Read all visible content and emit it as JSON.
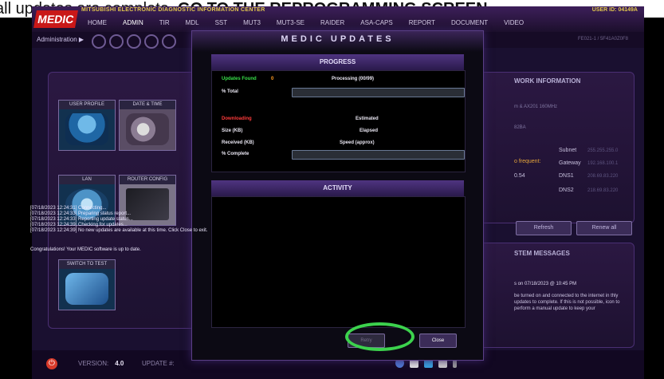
{
  "caption": {
    "part1": "all updates are complete, ",
    "part2": "GO TO THE REPROGRAMMING SCREEN"
  },
  "app": {
    "logo": "MEDIC",
    "title": "MITSUBISHI ELECTRONIC DIAGNOSTIC INFORMATION CENTER",
    "user_id_label": "USER ID:",
    "user_id_value": "04149A",
    "nav_tabs": [
      "HOME",
      "ADMIN",
      "TIR",
      "MDL",
      "SST",
      "MUT3",
      "MUT3-SE",
      "RAIDER",
      "ASA-CAPS",
      "REPORT",
      "DOCUMENT",
      "VIDEO"
    ],
    "breadcrumb": "Administration  ▶",
    "id_text": "FE021-1 / 5F41A0Z0F8"
  },
  "left_tiles": [
    {
      "label": "USER PROFILE"
    },
    {
      "label": "DATE & TIME"
    },
    {
      "label": "LAN"
    },
    {
      "label": "ROUTER CONFIG"
    },
    {
      "label": "SWITCH TO TEST"
    }
  ],
  "right_panel": {
    "title": "WORK INFORMATION",
    "cpu_text": "m & AX201 160MHz",
    "mac_text": "82BA",
    "freq_label": "o frequent:",
    "freq_value": "0.54",
    "subnet_label": "Subnet",
    "subnet_value": "255.255.255.0",
    "gateway_label": "Gateway",
    "gateway_value": "192.168.100.1",
    "dns1_label": "DNS1",
    "dns1_value": "208.69.83.220",
    "dns2_label": "DNS2",
    "dns2_value": "218.69.83.220",
    "refresh_label": "Refresh",
    "renew_label": "Renew all"
  },
  "messages_panel": {
    "title": "STEM MESSAGES",
    "date_line": "s on 07/18/2023 @ 10:45 PM",
    "body": "be turned on and connected to the internet in thly updates to complete. If this is not possible, icon to perform a manual update to keep your"
  },
  "bottom": {
    "version_label": "VERSION:",
    "version_value": "4.0",
    "update_label": "UPDATE #:"
  },
  "modal": {
    "title": "MEDIC UPDATES",
    "progress_header": "PROGRESS",
    "updates_found_label": "Updates Found",
    "updates_found_value": "0",
    "processing_text": "Processing (00/99)",
    "total_label": "% Total",
    "total_progress": 0,
    "downloading_label": "Downloading",
    "estimated_label": "Estimated",
    "size_label": "Size (KB)",
    "elapsed_label": "Elapsed",
    "received_label": "Received (KB)",
    "speed_label": "Speed (approx)",
    "complete_label": "% Complete",
    "complete_progress": 0,
    "activity_header": "ACTIVITY",
    "activity_lines": [
      "[07/18/2023 12:24:31] Connecting...",
      "[07/18/2023 12:24:33] Preparing status report...",
      "[07/18/2023 12:24:33] Reporting update status...",
      "[07/18/2023 12:24:39] Checking for updates...",
      "[07/18/2023 12:24:39] No new updates are available at this time.  Click Close to exit."
    ],
    "congrats": "Congratulations!  Your MEDIC software is up to date.",
    "retry_label": "Retry",
    "close_label": "Close"
  },
  "colors": {
    "updates_found": "#38e04a",
    "downloading": "#ff3b3b",
    "count": "#ff9b21",
    "highlight": "#3cd24d"
  }
}
